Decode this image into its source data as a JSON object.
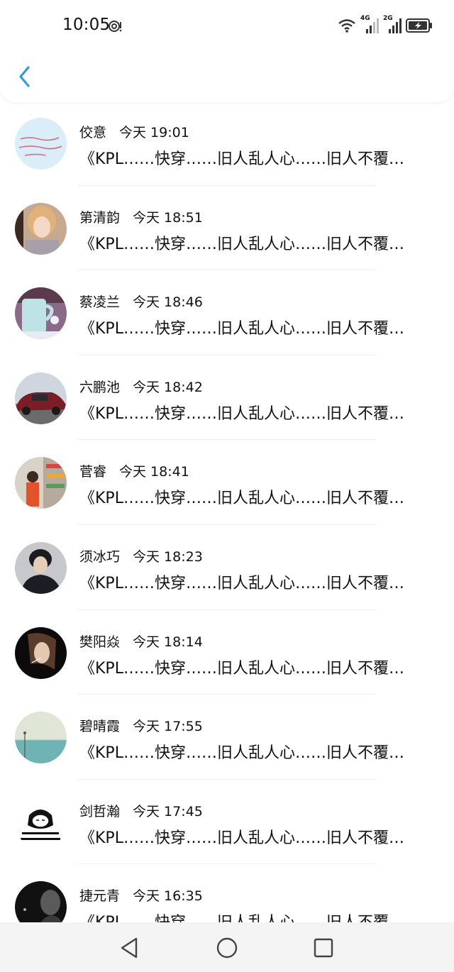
{
  "status_bar": {
    "time": "10:05",
    "network_4g": "4G",
    "network_2g": "2G",
    "icons": [
      "ring-icon",
      "wifi-icon",
      "signal-icon",
      "battery-charging-icon"
    ]
  },
  "header": {
    "back_icon": "chevron-left-icon"
  },
  "messages": [
    {
      "name": "佼意",
      "time": "今天 19:01",
      "text": "《KPL……快穿……旧人乱人心……旧人不覆…"
    },
    {
      "name": "第清韵",
      "time": "今天 18:51",
      "text": "《KPL……快穿……旧人乱人心……旧人不覆…"
    },
    {
      "name": "蔡凌兰",
      "time": "今天 18:46",
      "text": "《KPL……快穿……旧人乱人心……旧人不覆…"
    },
    {
      "name": "六鹏池",
      "time": "今天 18:42",
      "text": "《KPL……快穿……旧人乱人心……旧人不覆…"
    },
    {
      "name": "菅睿",
      "time": "今天 18:41",
      "text": "《KPL……快穿……旧人乱人心……旧人不覆…"
    },
    {
      "name": "须冰巧",
      "time": "今天 18:23",
      "text": "《KPL……快穿……旧人乱人心……旧人不覆…"
    },
    {
      "name": "樊阳焱",
      "time": "今天 18:14",
      "text": "《KPL……快穿……旧人乱人心……旧人不覆…"
    },
    {
      "name": "碧晴霞",
      "time": "今天 17:55",
      "text": "《KPL……快穿……旧人乱人心……旧人不覆…"
    },
    {
      "name": "剑哲瀚",
      "time": "今天 17:45",
      "text": "《KPL……快穿……旧人乱人心……旧人不覆…"
    },
    {
      "name": "捷元青",
      "time": "今天 16:35",
      "text": "《KPL……快穿……旧人乱人心……旧人不覆…"
    }
  ],
  "nav": {
    "back": "triangle-back-icon",
    "home": "circle-home-icon",
    "recents": "square-recents-icon"
  },
  "colors": {
    "accent": "#2f9be0",
    "background": "#ffffff",
    "nav_bg": "#f4f4f4"
  }
}
